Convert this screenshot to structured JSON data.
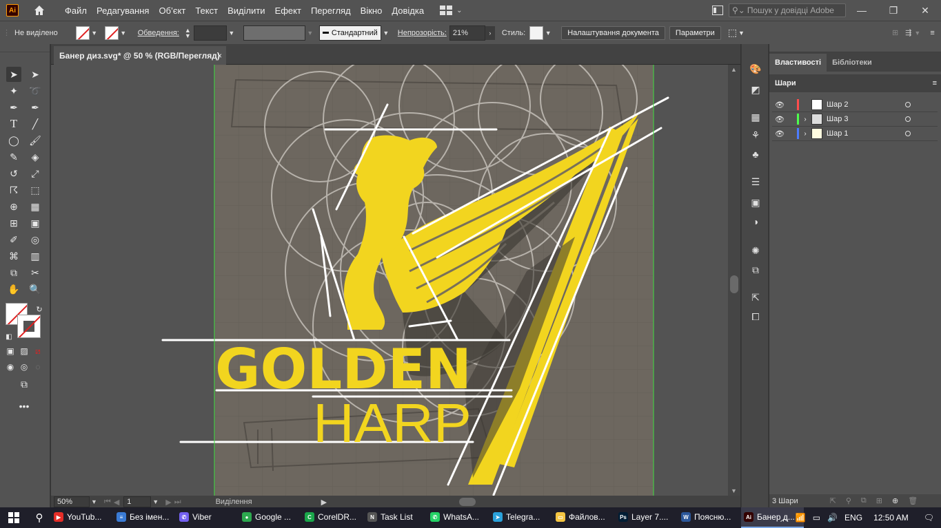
{
  "menubar": {
    "app_badge": "Ai",
    "menus": [
      "Файл",
      "Редагування",
      "Об’єкт",
      "Текст",
      "Виділити",
      "Ефект",
      "Перегляд",
      "Вікно",
      "Довідка"
    ],
    "help_search_placeholder": "Пошук у довідці Adobe"
  },
  "controlbar": {
    "selection_state": "Не виділено",
    "stroke_label": "Обведення:",
    "stroke_style": "Стандартний",
    "opacity_label": "Непрозорість:",
    "opacity_value": "21%",
    "style_label": "Стиль:",
    "doc_setup_button": "Налаштування документа",
    "prefs_button": "Параметри"
  },
  "document_tab": {
    "title": "Банер диз.svg* @ 50 % (RGB/Перегляд)",
    "close": "×"
  },
  "artwork": {
    "word1": "GOLDEN",
    "word2": "HARP",
    "gold": "#f2d51f",
    "line_color": "#ffffff"
  },
  "statusbar": {
    "zoom": "50%",
    "artboard_number": "1",
    "mode": "Виділення"
  },
  "panels": {
    "tabs": [
      "Властивості",
      "Бібліотеки"
    ],
    "layers_title": "Шари",
    "layers": [
      {
        "name": "Шар 2",
        "color": "#ff4d4d",
        "expandable": false
      },
      {
        "name": "Шар 3",
        "color": "#4dff4d",
        "expandable": true
      },
      {
        "name": "Шар 1",
        "color": "#4d7dff",
        "expandable": true
      }
    ],
    "layer_count": "3 Шари"
  },
  "taskbar": {
    "apps": [
      {
        "label": "YouTub...",
        "icon_color": "#e52d27",
        "icon": "▶"
      },
      {
        "label": "Без імен...",
        "icon_color": "#3a7bd5",
        "icon": "≡"
      },
      {
        "label": "Viber",
        "icon_color": "#7360f2",
        "icon": "✆"
      },
      {
        "label": "Google ...",
        "icon_color": "#2da94f",
        "icon": "●"
      },
      {
        "label": "CorelDR...",
        "icon_color": "#1aa64a",
        "icon": "C"
      },
      {
        "label": "Task List",
        "icon_color": "#555555",
        "icon": "N"
      },
      {
        "label": "WhatsA...",
        "icon_color": "#25d366",
        "icon": "✆"
      },
      {
        "label": "Telegra...",
        "icon_color": "#2aa1da",
        "icon": "➤"
      },
      {
        "label": "Файлов...",
        "icon_color": "#f4c542",
        "icon": "▭"
      },
      {
        "label": "Layer 7....",
        "icon_color": "#001d34",
        "icon": "Ps"
      },
      {
        "label": "Поясню...",
        "icon_color": "#2b579a",
        "icon": "W"
      },
      {
        "label": "Банер д...",
        "icon_color": "#330000",
        "icon": "Ai"
      }
    ],
    "language": "ENG",
    "time": "12:50 AM"
  }
}
